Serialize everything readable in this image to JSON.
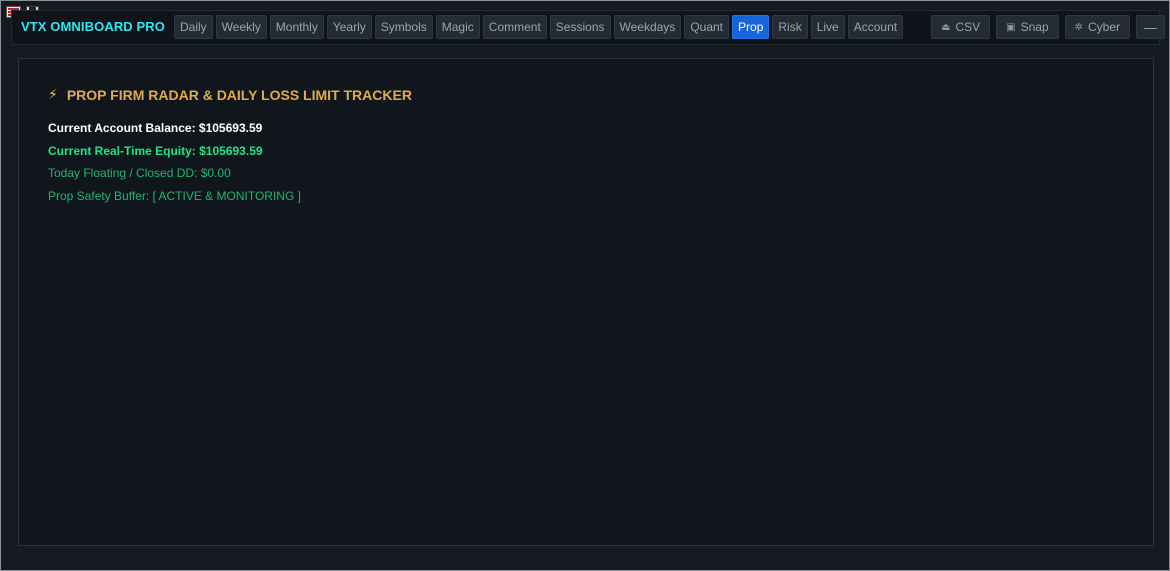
{
  "app": {
    "title": "VTX OMNIBOARD PRO"
  },
  "tabs": [
    {
      "label": "Daily",
      "active": false
    },
    {
      "label": "Weekly",
      "active": false
    },
    {
      "label": "Monthly",
      "active": false
    },
    {
      "label": "Yearly",
      "active": false
    },
    {
      "label": "Symbols",
      "active": false
    },
    {
      "label": "Magic",
      "active": false
    },
    {
      "label": "Comment",
      "active": false
    },
    {
      "label": "Sessions",
      "active": false
    },
    {
      "label": "Weekdays",
      "active": false
    },
    {
      "label": "Quant",
      "active": false
    },
    {
      "label": "Prop",
      "active": true
    },
    {
      "label": "Risk",
      "active": false
    },
    {
      "label": "Live",
      "active": false
    },
    {
      "label": "Account",
      "active": false
    }
  ],
  "actions": {
    "csv": {
      "label": "CSV",
      "icon": "export-icon"
    },
    "snap": {
      "label": "Snap",
      "icon": "camera-icon"
    },
    "cyber": {
      "label": "Cyber",
      "icon": "palette-icon"
    },
    "minimize": {
      "label": "—"
    }
  },
  "prop": {
    "title": "PROP FIRM RADAR & DAILY LOSS LIMIT TRACKER",
    "title_icon": "bolt-icon",
    "balance_line": "Current Account Balance: $105693.59",
    "equity_line": "Current Real-Time Equity: $105693.59",
    "dd_line": "Today Floating / Closed DD: $0.00",
    "buffer_line": "Prop Safety Buffer: [ ACTIVE & MONITORING ]"
  },
  "colors": {
    "brand": "#2ee6f0",
    "accent_tab": "#1565d8",
    "title": "#e1aa4c",
    "equity": "#23e28a",
    "status": "#20b56f",
    "background": "#151a20"
  }
}
